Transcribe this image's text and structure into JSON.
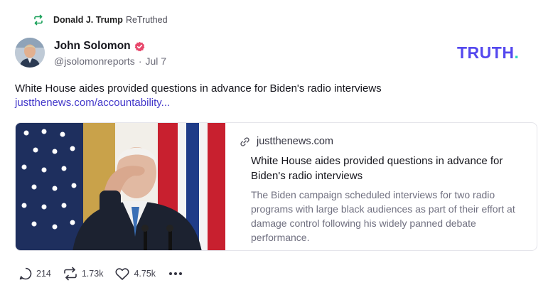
{
  "retruth": {
    "name": "Donald J. Trump",
    "suffix": "ReTruthed"
  },
  "author": {
    "name": "John Solomon",
    "handle": "@jsolomonreports",
    "separator": "·",
    "date": "Jul 7",
    "verified": true
  },
  "logo": {
    "text": "TRUTH",
    "dot": ".",
    "brand_color": "#5448ee",
    "dot_color": "#2fd6c1"
  },
  "post": {
    "text": "White House aides provided questions in advance for Biden's radio interviews",
    "link": "justthenews.com/accountability..."
  },
  "card": {
    "domain": "justthenews.com",
    "title": "White House aides provided questions in advance for Biden's radio interviews",
    "description": "The Biden campaign scheduled interviews for two radio programs with large black audiences as part of their effort at damage control following his widely panned debate performance."
  },
  "actions": {
    "replies": "214",
    "retruths": "1.73k",
    "likes": "4.75k"
  },
  "colors": {
    "link": "#4338ca",
    "retruth_green": "#18a058",
    "verified_pink": "#e8486c"
  }
}
